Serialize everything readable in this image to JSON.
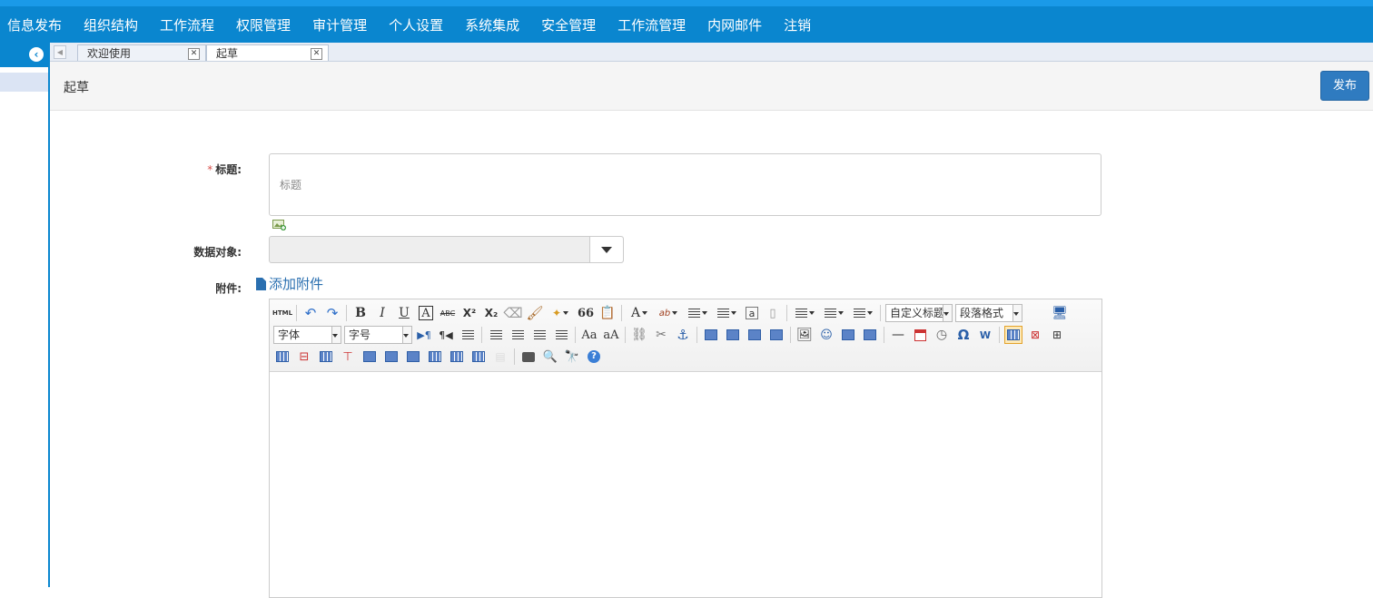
{
  "nav": {
    "items": [
      "信息发布",
      "组织结构",
      "工作流程",
      "权限管理",
      "审计管理",
      "个人设置",
      "系统集成",
      "安全管理",
      "工作流管理",
      "内网邮件",
      "注销"
    ]
  },
  "tabs": [
    {
      "label": "欢迎使用"
    },
    {
      "label": "起草"
    }
  ],
  "page": {
    "title": "起草",
    "publish_label": "发布"
  },
  "form": {
    "title_label": "标题:",
    "title_required": "*",
    "title_placeholder": "标题",
    "data_object_label": "数据对象:",
    "attachment_label": "附件:",
    "add_attachment": "添加附件"
  },
  "editor": {
    "html_label": "HTML",
    "custom_title": "自定义标题",
    "paragraph_format": "段落格式",
    "font_family": "字体",
    "font_size": "字号",
    "bold": "B",
    "italic": "I",
    "underline": "U",
    "font_border": "A",
    "strike": "ABC",
    "superscript": "X²",
    "subscript": "X₂",
    "quote": "66",
    "font_color": "A",
    "omega": "Ω",
    "help": "?"
  },
  "colors": {
    "nav_bg": "#0a86cf",
    "nav_top": "#1a9ae8",
    "publish_bg": "#2f7bc0",
    "link": "#2a6fb0",
    "required": "#d9534f"
  }
}
